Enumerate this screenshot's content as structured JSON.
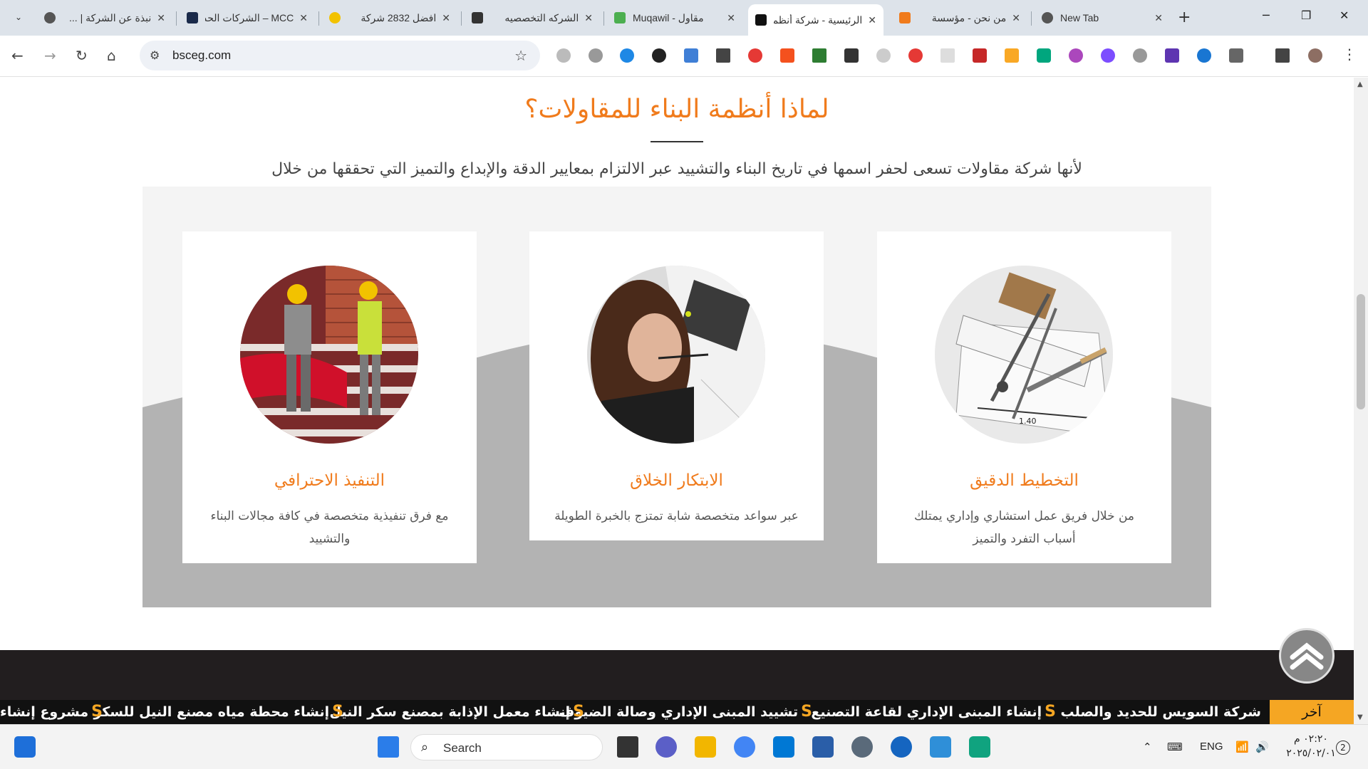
{
  "tabs": [
    {
      "title": "نبذة عن الشركة | ...",
      "color": "#555"
    },
    {
      "title": "MCC – الشركات الحديثه",
      "color": "#1a2a4a"
    },
    {
      "title": "افضل 2832 شركة",
      "color": "#f2c200"
    },
    {
      "title": "الشركه التخصصيه",
      "color": "#333"
    },
    {
      "title": "Muqawil - مقاول",
      "color": "#4caf50"
    },
    {
      "title": "الرئيسية - شركة أنظمة",
      "color": "#111"
    },
    {
      "title": "من نحن - مؤسسة",
      "color": "#f07b1c"
    },
    {
      "title": "New Tab",
      "color": "#555"
    }
  ],
  "browser": {
    "url": "bsceg.com",
    "icons": {
      "back": "back-arrow-icon",
      "forward": "forward-arrow-icon",
      "reload": "reload-icon",
      "home": "home-icon",
      "star": "star-icon"
    }
  },
  "page": {
    "title": "لماذا أنظمة البناء للمقاولات؟",
    "subtitle": "لأنها شركة مقاولات تسعى لحفر اسمها في تاريخ البناء والتشييد عبر الالتزام بمعايير الدقة والإبداع والتميز التي تحققها من خلال",
    "cards": [
      {
        "title": "التخطيط الدقيق",
        "text": "من خلال فريق عمل استشاري وإداري يمتلك أسباب التفرد والتميز"
      },
      {
        "title": "الابتكار الخلاق",
        "text": "عبر سواعد متخصصة شابة تمتزج بالخبرة الطويلة"
      },
      {
        "title": "التنفيذ الاحترافي",
        "text": "مع فرق تنفيذية متخصصة في كافة مجالات البناء والتشييد"
      }
    ],
    "drawing_label": "1.40"
  },
  "ticker": {
    "label": "آخر المستجدات",
    "items": [
      "شركة السويس للحديد والصلب",
      "إنشاء المبنى الإداري لقاعة التصنيع",
      "تشييد المبنى الإداري وصالة الضيوف",
      "إنشاء معمل الإذابة بمصنع سكر النيل",
      "إنشاء محطة مياه مصنع النيل للسكر",
      "مشروع إنشاء etle"
    ],
    "s_glyph": "S"
  },
  "taskbar": {
    "search_label": "Search",
    "language": "ENG",
    "time": "٠٢:٢٠ م",
    "date": "٢٠٢٥/٠٢/٠١",
    "notification_count": "2"
  }
}
